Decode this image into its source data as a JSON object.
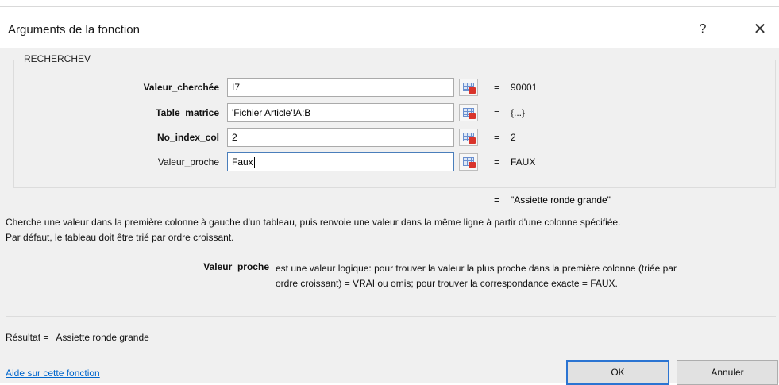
{
  "dialog": {
    "title": "Arguments de la fonction",
    "help_label": "?",
    "close_label": "✕"
  },
  "function": {
    "name": "RECHERCHEV",
    "args": [
      {
        "label": "Valeur_cherchée",
        "value": "I7",
        "result_eq": "=",
        "result": "90001",
        "required": true
      },
      {
        "label": "Table_matrice",
        "value": "'Fichier Article'!A:B",
        "result_eq": "=",
        "result": "{...}",
        "required": true
      },
      {
        "label": "No_index_col",
        "value": "2",
        "result_eq": "=",
        "result": "2",
        "required": true
      },
      {
        "label": "Valeur_proche",
        "value": "Faux",
        "result_eq": "=",
        "result": "FAUX",
        "required": false
      }
    ],
    "formula_eq": "=",
    "formula_result": "\"Assiette ronde grande\"",
    "description_line1": "Cherche une valeur dans la première colonne à gauche d'un tableau, puis renvoie une valeur dans la même ligne à partir d'une colonne spécifiée.",
    "description_line2": "Par défaut, le tableau doit être trié par ordre croissant.",
    "param_name": "Valeur_proche",
    "param_desc_line1": "est une valeur logique: pour trouver la valeur la plus proche dans la première colonne (triée par",
    "param_desc_line2": "ordre croissant) = VRAI ou omis; pour trouver la correspondance exacte = FAUX."
  },
  "result": {
    "label": "Résultat =",
    "value": "Assiette ronde grande"
  },
  "footer": {
    "help_link": "Aide sur cette fonction",
    "ok_label": "OK",
    "cancel_label": "Annuler"
  },
  "colors": {
    "link": "#0066cc",
    "dialog_bg": "#f0f0f0",
    "ok_border": "#2b74d2"
  },
  "icons": {
    "range_selector": "collapse-dialog-icon"
  }
}
